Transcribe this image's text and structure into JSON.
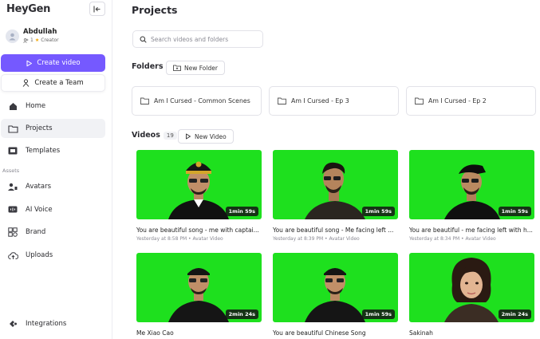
{
  "app": {
    "brand": "HeyGen"
  },
  "user": {
    "name": "Abdullah",
    "member_count": "1",
    "plan": "Creator"
  },
  "sidebar": {
    "create_video_label": "Create video",
    "create_team_label": "Create a Team",
    "nav": [
      {
        "label": "Home",
        "icon": "home-icon"
      },
      {
        "label": "Projects",
        "icon": "folder-icon",
        "active": true
      },
      {
        "label": "Templates",
        "icon": "templates-icon"
      }
    ],
    "assets_label": "Assets",
    "assets": [
      {
        "label": "Avatars",
        "icon": "avatars-icon"
      },
      {
        "label": "AI Voice",
        "icon": "voice-icon"
      },
      {
        "label": "Brand",
        "icon": "brand-icon"
      },
      {
        "label": "Uploads",
        "icon": "upload-icon"
      }
    ],
    "integrations_label": "Integrations"
  },
  "main": {
    "title": "Projects",
    "search_placeholder": "Search videos and folders",
    "folders_title": "Folders",
    "new_folder_label": "New Folder",
    "folders": [
      {
        "name": "Am I Cursed - Common Scenes"
      },
      {
        "name": "Am I Cursed - Ep 3"
      },
      {
        "name": "Am I Cursed - Ep 2"
      }
    ],
    "videos_title": "Videos",
    "videos_count": "19",
    "new_video_label": "New Video",
    "videos": [
      {
        "title": "You are beautiful song - me with captai...",
        "meta": "Yesterday at 8:58 PM • Avatar Video",
        "duration": "1min 59s"
      },
      {
        "title": "You are beautiful song - Me facing left ...",
        "meta": "Yesterday at 8:39 PM • Avatar Video",
        "duration": "1min 59s"
      },
      {
        "title": "You are beautiful - me facing left with h...",
        "meta": "Yesterday at 8:34 PM • Avatar Video",
        "duration": "1min 59s"
      },
      {
        "title": "Me Xiao Cao",
        "meta": "",
        "duration": "2min 24s"
      },
      {
        "title": "You are beautiful Chinese Song",
        "meta": "",
        "duration": "1min 59s"
      },
      {
        "title": "Sakinah",
        "meta": "",
        "duration": "2min 24s"
      }
    ]
  },
  "colors": {
    "accent": "#7559ff",
    "green_screen": "#1ee01e"
  }
}
